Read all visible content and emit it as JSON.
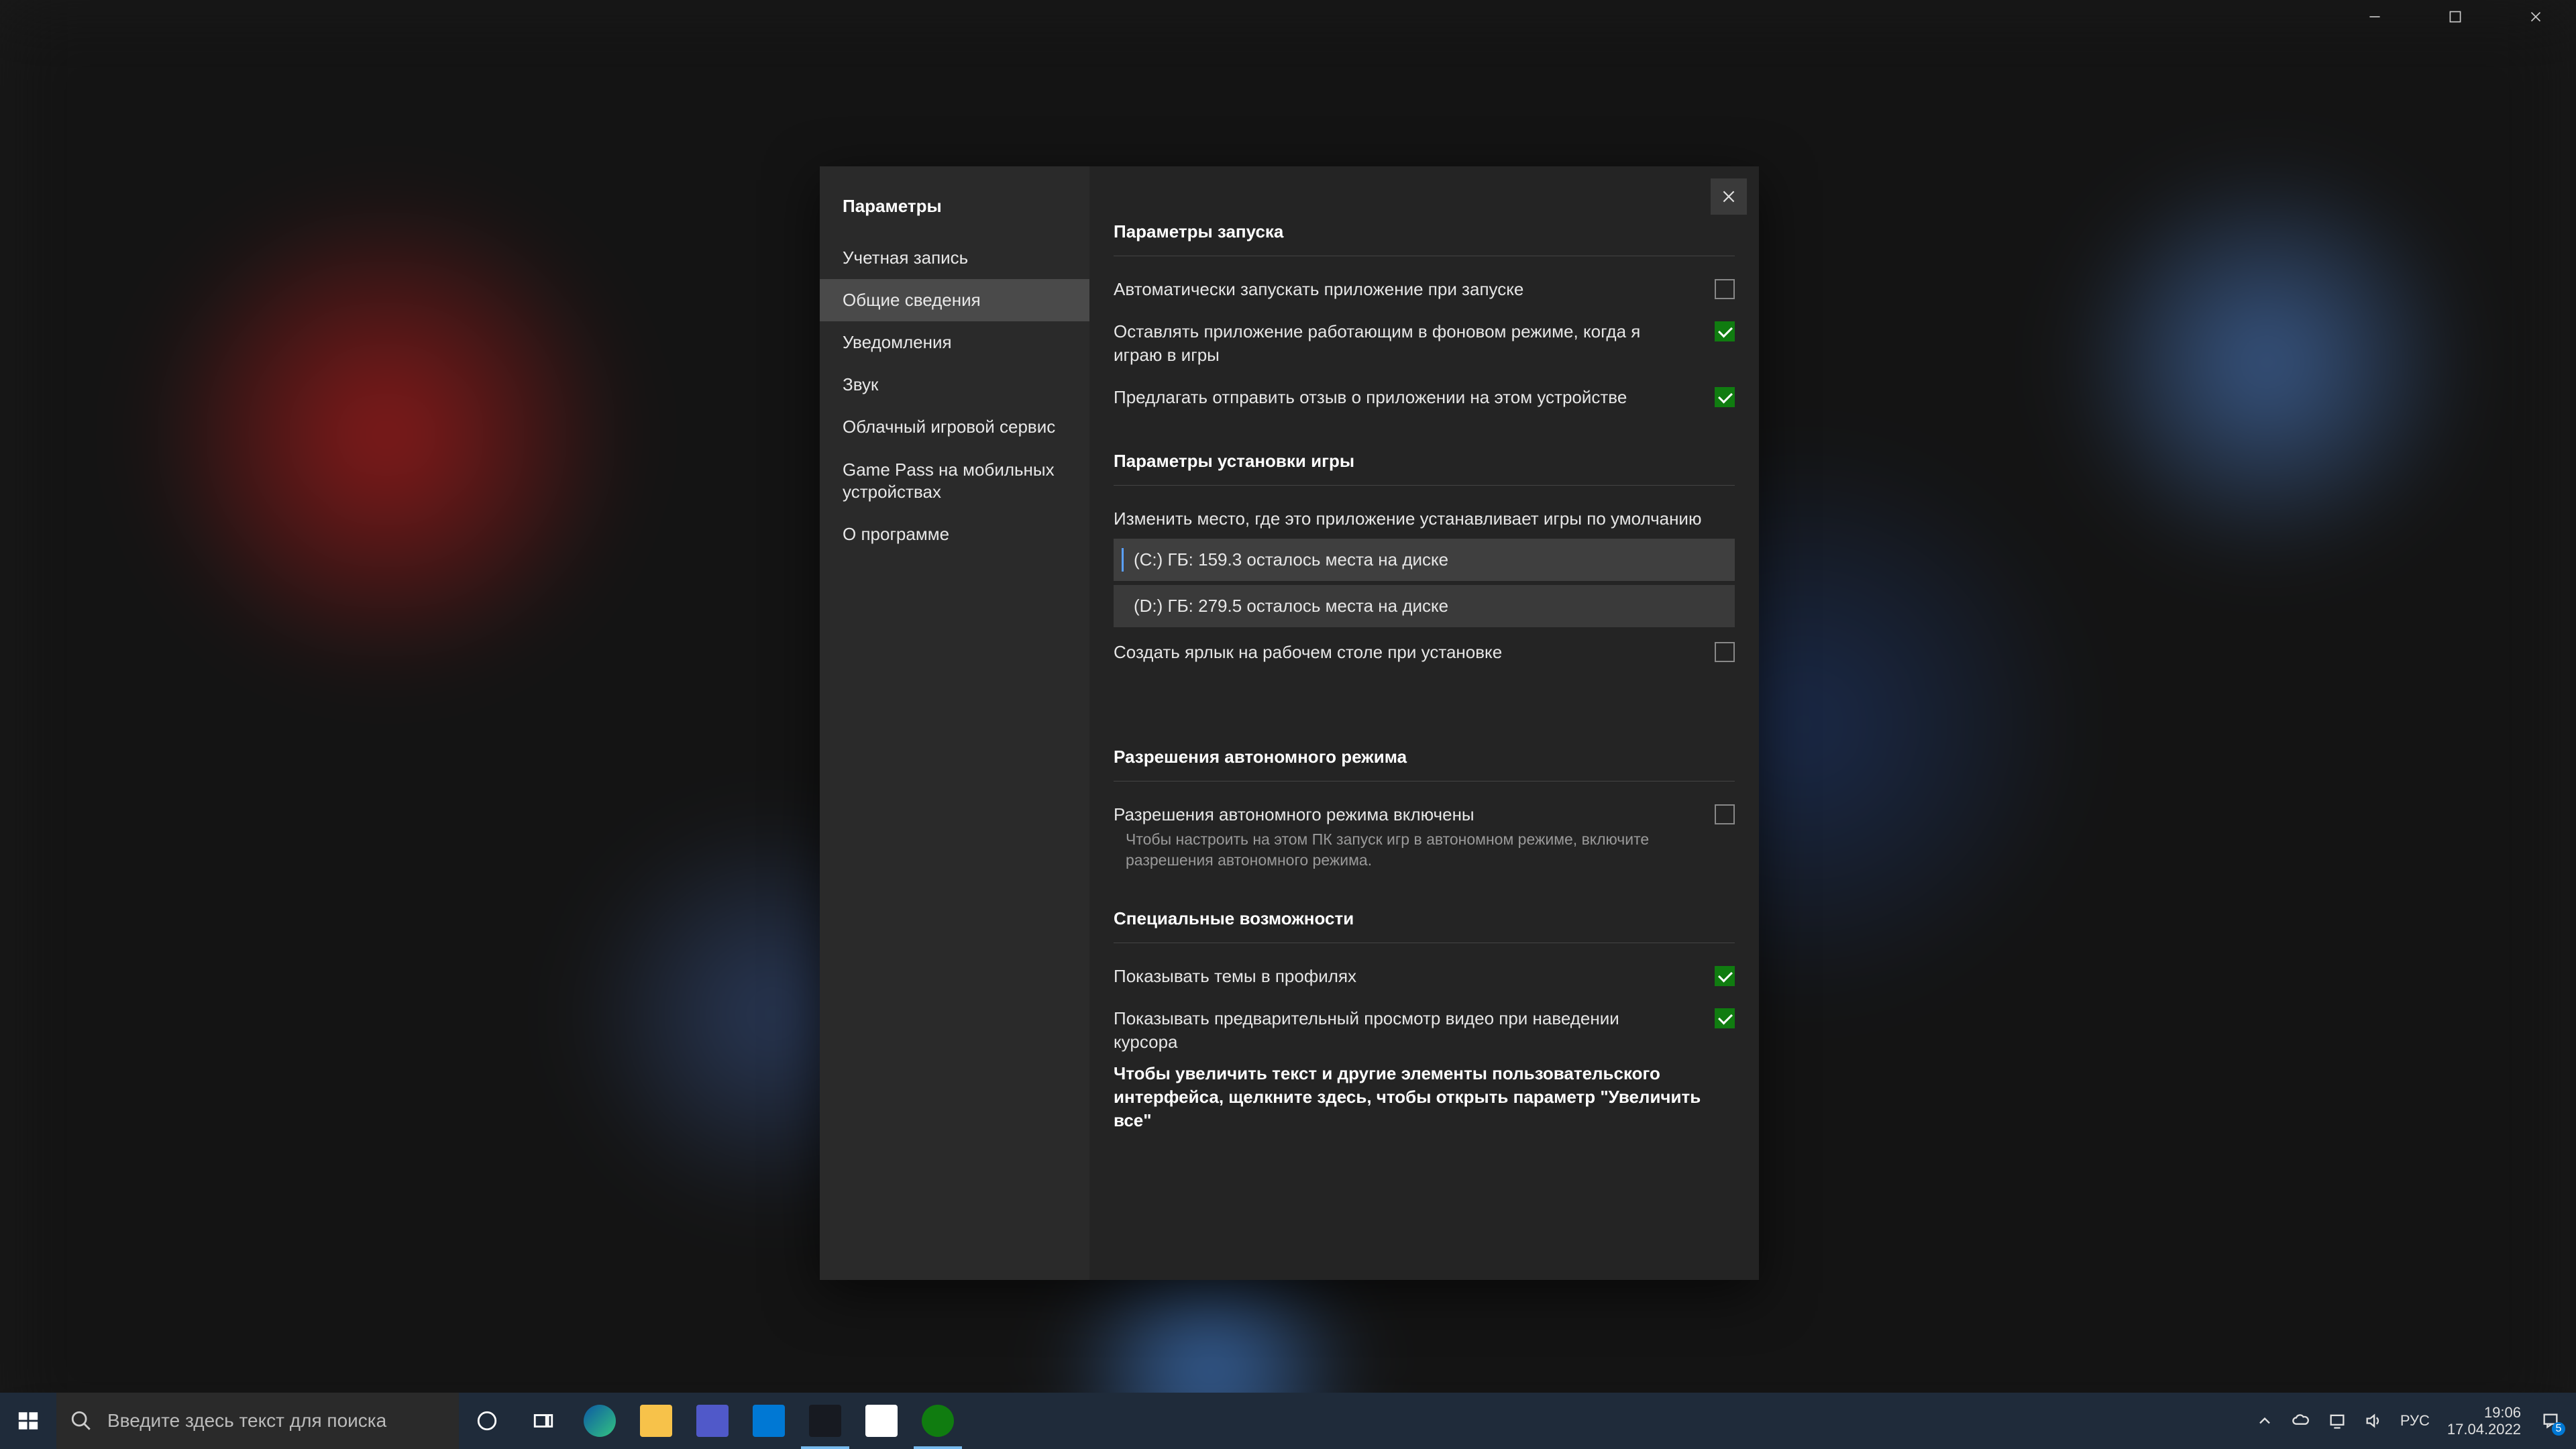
{
  "window_controls": {
    "min": "minimize",
    "max": "maximize",
    "close": "close"
  },
  "dialog": {
    "title": "Параметры",
    "nav": [
      "Учетная запись",
      "Общие сведения",
      "Уведомления",
      "Звук",
      "Облачный игровой сервис",
      "Game Pass на мобильных устройствах",
      "О программе"
    ],
    "active_nav_index": 1,
    "sections": {
      "launch": {
        "header": "Параметры запуска",
        "auto_start": {
          "label": "Автоматически запускать приложение при запуске",
          "checked": false
        },
        "keep_bg": {
          "label": "Оставлять приложение работающим в фоновом режиме, когда я играю в игры",
          "checked": true
        },
        "feedback": {
          "label": "Предлагать отправить отзыв о приложении на этом устройстве",
          "checked": true
        }
      },
      "install": {
        "header": "Параметры установки игры",
        "change_location_label": "Изменить место, где это приложение устанавливает игры по умолчанию",
        "drives": [
          {
            "label": "(C:) ГБ: 159.3 осталось места на диске",
            "selected": true
          },
          {
            "label": "(D:) ГБ: 279.5 осталось места на диске",
            "selected": false
          }
        ],
        "desktop_shortcut": {
          "label": "Создать ярлык на рабочем столе при установке",
          "checked": false
        }
      },
      "offline": {
        "header": "Разрешения автономного режима",
        "enabled": {
          "label": "Разрешения автономного режима включены",
          "checked": false
        },
        "hint": "Чтобы настроить на этом ПК запуск игр в автономном режиме, включите разрешения автономного режима."
      },
      "accessibility": {
        "header": "Специальные возможности",
        "show_themes": {
          "label": "Показывать темы в профилях",
          "checked": true
        },
        "video_preview": {
          "label": "Показывать предварительный просмотр видео при наведении курсора",
          "checked": true
        },
        "zoom_hint": "Чтобы увеличить текст и другие элементы пользовательского интерфейса, щелкните здесь, чтобы открыть параметр \"Увеличить все\""
      }
    }
  },
  "taskbar": {
    "search_placeholder": "Введите здесь текст для поиска",
    "lang": "РУС",
    "time": "19:06",
    "date": "17.04.2022",
    "notif_count": "5",
    "apps": [
      {
        "name": "cortana",
        "color": "transparent"
      },
      {
        "name": "task-view",
        "color": "transparent"
      },
      {
        "name": "edge",
        "color": "#2f7bd1"
      },
      {
        "name": "file-explorer",
        "color": "#f7c24a"
      },
      {
        "name": "teams",
        "color": "#5059c9"
      },
      {
        "name": "mail",
        "color": "#0078d4"
      },
      {
        "name": "steam",
        "color": "#dcdcdc"
      },
      {
        "name": "store",
        "color": "#ffffff"
      },
      {
        "name": "xbox",
        "color": "#107c10"
      }
    ]
  }
}
